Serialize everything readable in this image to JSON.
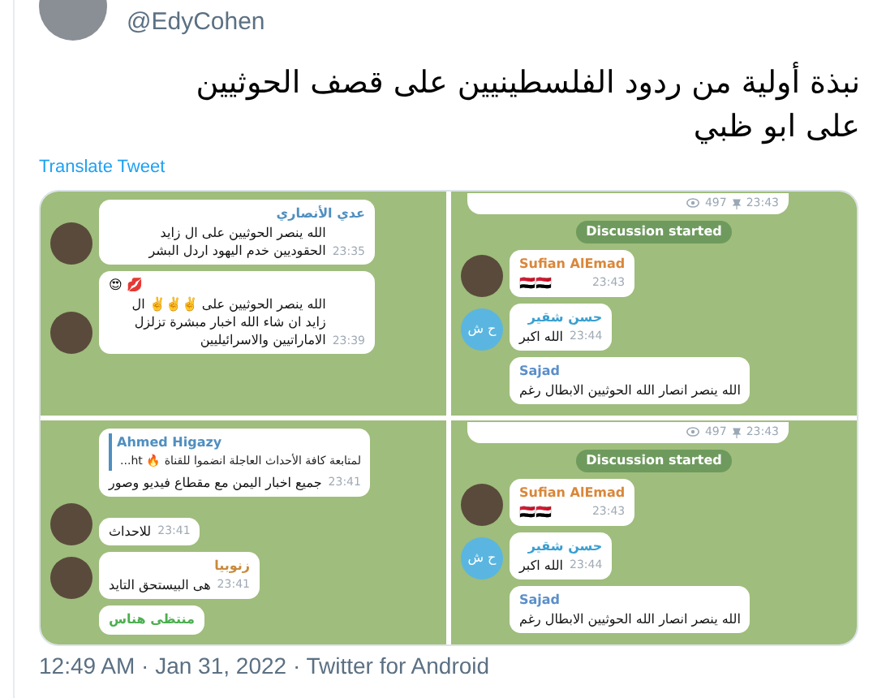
{
  "tweet": {
    "handle": "@EdyCohen",
    "text": "نبذة أولية من ردود الفلسطينيين على قصف الحوثيين على ابو ظبي",
    "translate_link": "Translate Tweet",
    "footer": "12:49 AM · Jan 31, 2022 · Twitter for Android"
  },
  "images": [
    {
      "items": [
        {
          "kind": "message",
          "sender": "عدي الأنصاري",
          "color": "#4f8fc0",
          "text": "الله ينصر الحوثيين على ال زايد الحقوديين خدم اليهود اردل البشر",
          "time": "23:35",
          "avatar": {
            "kind": "photo"
          }
        },
        {
          "kind": "message",
          "emoji": "😍 💋",
          "text": "الله ينصر الحوثيين على ✌️✌️✌️ ال زايد ان شاء الله اخبار مبشرة تزلزل الاماراتيين والاسرائيليين",
          "time": "23:39",
          "avatar": {
            "kind": "photo"
          }
        }
      ]
    },
    {
      "items": [
        {
          "kind": "message",
          "reply": {
            "name": "Ahmed Higazy",
            "text": "لمتابعة كافة الأحداث العاجلة انضموا للقناة 🔥 ht..."
          },
          "text": "جميع اخبار اليمن مع مقطاع فيديو وصور",
          "time": "23:41"
        },
        {
          "kind": "message",
          "text": "للاحداث",
          "time": "23:41",
          "avatar": {
            "kind": "photo"
          }
        },
        {
          "kind": "message",
          "sender": "زنوبيا",
          "color": "#c98a3a",
          "text": "هى البيستحق التايد",
          "time": "23:41",
          "avatar": {
            "kind": "photo"
          }
        },
        {
          "kind": "message",
          "sender": "منتظى هناس",
          "color": "#4caf50"
        }
      ]
    },
    {
      "items": [
        {
          "kind": "views",
          "views": "497",
          "time": "23:43"
        },
        {
          "kind": "service",
          "text": "Discussion started"
        },
        {
          "kind": "message",
          "sender": "Sufian AlEmad",
          "color": "#d9873a",
          "text": "🇾🇪🇾🇪",
          "time": "23:43",
          "avatar": {
            "kind": "photo"
          }
        },
        {
          "kind": "message",
          "sender": "حسن شقير",
          "color": "#3a9fd0",
          "text": "الله اكبر",
          "time": "23:44",
          "avatar": {
            "kind": "initials",
            "initials": "ح ش"
          }
        },
        {
          "kind": "message",
          "sender": "Sajad",
          "color": "#5b8fc9",
          "text": "الله ينصر انصار الله الحوثيين الابطال رغم"
        }
      ]
    },
    {
      "items": [
        {
          "kind": "views",
          "views": "497",
          "time": "23:43"
        },
        {
          "kind": "service",
          "text": "Discussion started"
        },
        {
          "kind": "message",
          "sender": "Sufian AlEmad",
          "color": "#d9873a",
          "text": "🇾🇪🇾🇪",
          "time": "23:43",
          "avatar": {
            "kind": "photo"
          }
        },
        {
          "kind": "message",
          "sender": "حسن شقير",
          "color": "#3a9fd0",
          "text": "الله اكبر",
          "time": "23:44",
          "avatar": {
            "kind": "initials",
            "initials": "ح ش"
          }
        },
        {
          "kind": "message",
          "sender": "Sajad",
          "color": "#5b8fc9",
          "text": "الله ينصر انصار الله الحوثيين الابطال رغم"
        }
      ]
    }
  ]
}
